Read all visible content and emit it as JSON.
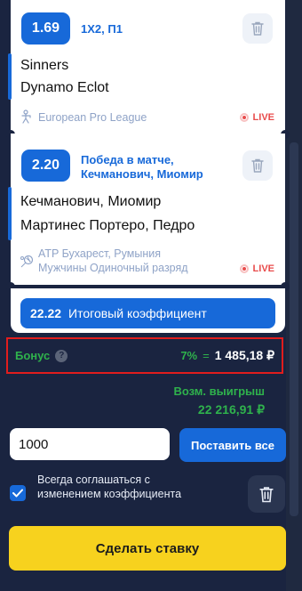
{
  "bets": [
    {
      "odds": "1.69",
      "market": "1Х2, П1",
      "team1": "Sinners",
      "team2": "Dynamo Eclot",
      "league": "European Pro League",
      "sport_icon": "esports-shooter-icon",
      "live": "LIVE"
    },
    {
      "odds": "2.20",
      "market_line1": "Победа в матче,",
      "market_line2": "Кечманович, Миомир",
      "team1": "Кечманович, Миомир",
      "team2": "Мартинес Портеро, Педро",
      "league_line1": "ATP Бухарест, Румыния",
      "league_line2": "Мужчины Одиночный разряд",
      "sport_icon": "tennis-icon",
      "live": "LIVE"
    }
  ],
  "total": {
    "value": "22.22",
    "label": "Итоговый коэффициент"
  },
  "bonus": {
    "label": "Бонус",
    "help": "?",
    "percent": "7%",
    "equals": "=",
    "amount": "1 485,18 ₽"
  },
  "winnings": {
    "label": "Возм. выигрыш",
    "amount": "22 216,91 ₽"
  },
  "stake": {
    "value": "1000"
  },
  "bet_all": {
    "label": "Поставить все"
  },
  "accept_changes": {
    "label": "Всегда соглашаться с изменением коэффициента",
    "checked": true
  },
  "place_bet": {
    "label": "Сделать ставку"
  },
  "colors": {
    "accent": "#1769d9",
    "bonus_green": "#2fb24c",
    "cta_yellow": "#f7d21e",
    "live_red": "#e84c4c",
    "highlight_red": "#e11d1d"
  }
}
